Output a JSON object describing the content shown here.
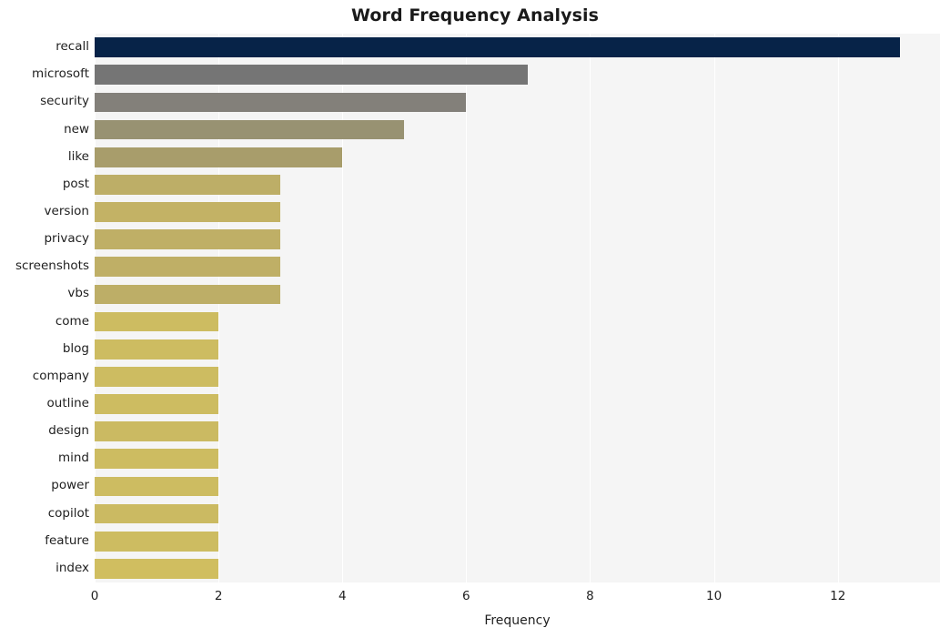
{
  "chart_data": {
    "type": "bar",
    "orientation": "horizontal",
    "title": "Word Frequency Analysis",
    "xlabel": "Frequency",
    "ylabel": "",
    "xlim": [
      0,
      13.65
    ],
    "xticks": [
      0,
      2,
      4,
      6,
      8,
      10,
      12
    ],
    "xtick_labels": [
      "0",
      "2",
      "4",
      "6",
      "8",
      "10",
      "12"
    ],
    "grid": true,
    "grid_axis": "x",
    "legend": false,
    "categories": [
      "recall",
      "microsoft",
      "security",
      "new",
      "like",
      "post",
      "version",
      "privacy",
      "screenshots",
      "vbs",
      "come",
      "blog",
      "company",
      "outline",
      "design",
      "mind",
      "power",
      "copilot",
      "feature",
      "index"
    ],
    "values": [
      13,
      7,
      6,
      5,
      4,
      3,
      3,
      3,
      3,
      3,
      2,
      2,
      2,
      2,
      2,
      2,
      2,
      2,
      2,
      2
    ],
    "bar_colors": [
      "#072348",
      "#757575",
      "#83807a",
      "#989272",
      "#a89d6b",
      "#bdae67",
      "#c3b265",
      "#bfaf66",
      "#bfaf66",
      "#bdae67",
      "#cdbc61",
      "#cdbc61",
      "#cdbc61",
      "#cdbc61",
      "#cbba62",
      "#cdbc61",
      "#cdbc61",
      "#cbba62",
      "#cdbc61",
      "#d0be60"
    ],
    "colors": {
      "plot_background": "#f5f5f5",
      "figure_background": "#ffffff",
      "gridline": "#ffffff",
      "text": "#1f1f1f",
      "title": "#1a1a1a"
    }
  }
}
